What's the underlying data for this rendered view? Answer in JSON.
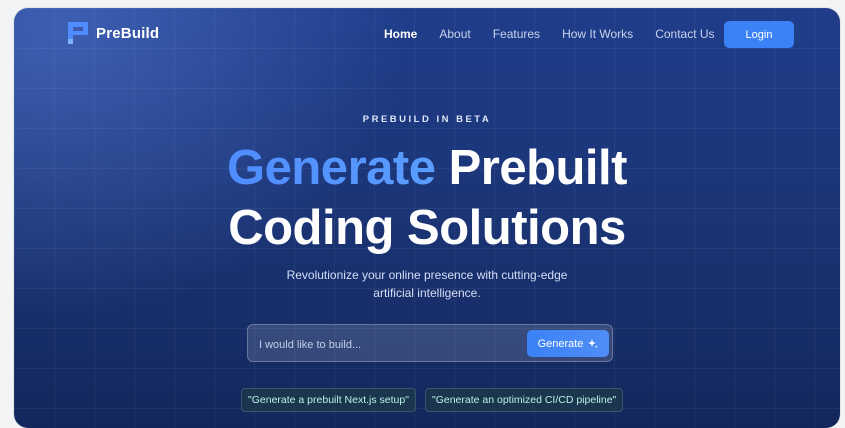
{
  "brand": {
    "name": "PreBuild"
  },
  "nav": {
    "links": [
      "Home",
      "About",
      "Features",
      "How It Works",
      "Contact Us"
    ],
    "active": "Home",
    "login_label": "Login"
  },
  "hero": {
    "tagline": "PREBUILD IN BETA",
    "headline_accent": "Generate",
    "headline_rest": " Prebuilt",
    "headline_line2": "Coding Solutions",
    "subtitle_line1": "Revolutionize your online presence with cutting-edge",
    "subtitle_line2": "artificial intelligence."
  },
  "search": {
    "placeholder": "I would like to build...",
    "value": "",
    "button_label": "Generate",
    "button_icon": "sparkle-icon"
  },
  "suggestions": [
    "\"Generate a prebuilt Next.js setup\"",
    "\"Generate an optimized CI/CD pipeline\""
  ],
  "colors": {
    "accent": "#3b82f6",
    "background": "#1b3577",
    "chip_text": "#b9f1e6"
  }
}
